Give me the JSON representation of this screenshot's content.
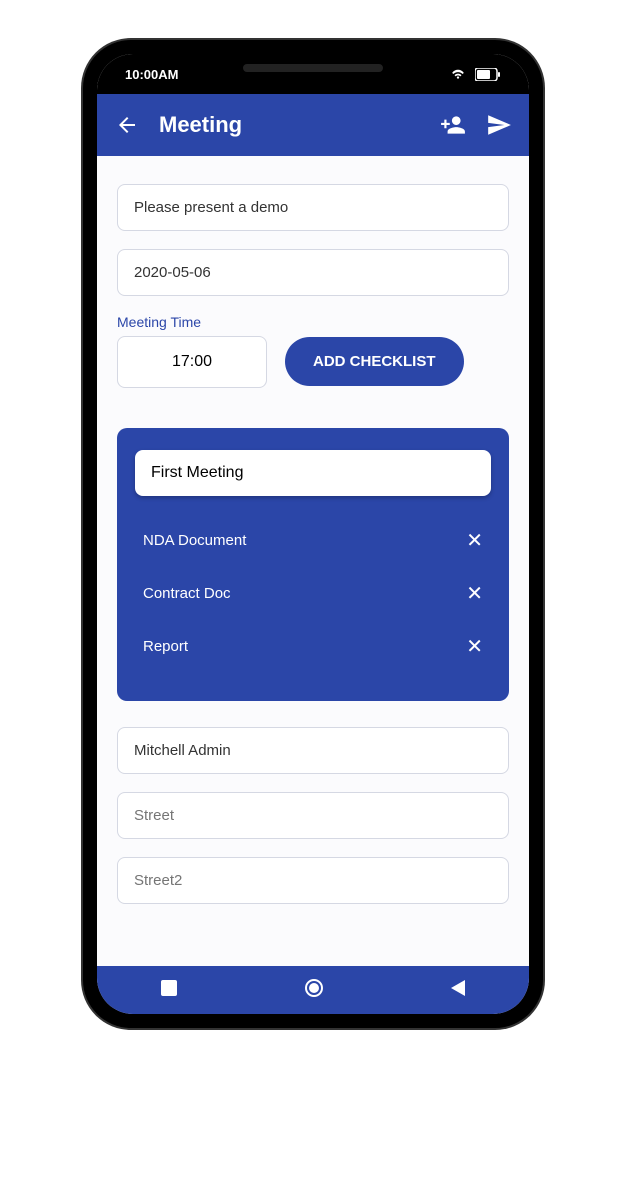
{
  "statusBar": {
    "time": "10:00AM"
  },
  "appBar": {
    "title": "Meeting"
  },
  "form": {
    "description": "Please present a demo",
    "date": "2020-05-06",
    "timeLabel": "Meeting Time",
    "time": "17:00",
    "addChecklistLabel": "ADD CHECKLIST",
    "partner": "Mitchell Admin",
    "street": "",
    "streetPlaceholder": "Street",
    "street2": "",
    "street2Placeholder": "Street2"
  },
  "checklist": {
    "title": "First Meeting",
    "items": [
      {
        "label": "NDA Document"
      },
      {
        "label": "Contract Doc"
      },
      {
        "label": "Report"
      }
    ]
  }
}
